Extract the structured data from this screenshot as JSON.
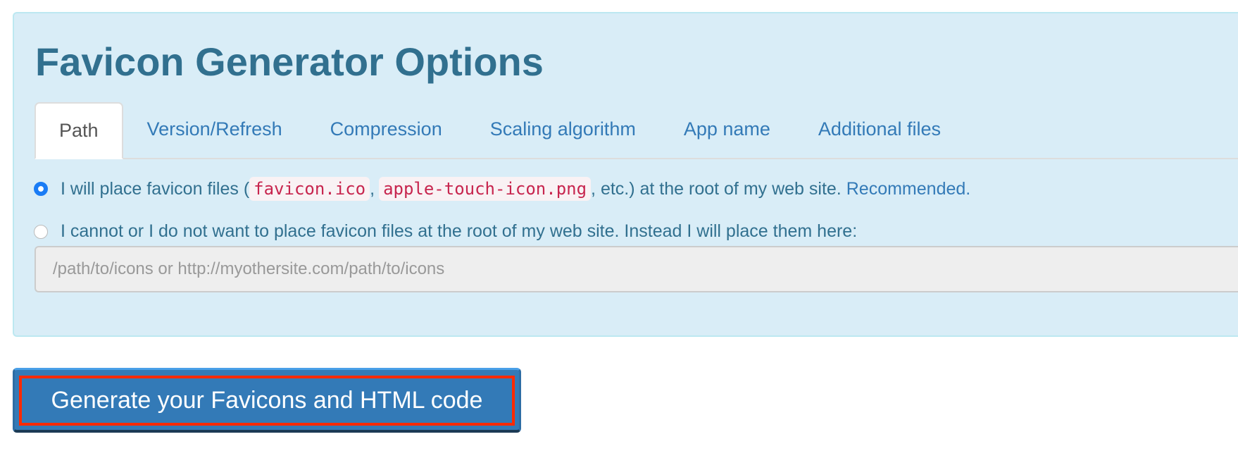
{
  "title": "Favicon Generator Options",
  "tabs": [
    {
      "label": "Path",
      "active": true
    },
    {
      "label": "Version/Refresh"
    },
    {
      "label": "Compression"
    },
    {
      "label": "Scaling algorithm"
    },
    {
      "label": "App name"
    },
    {
      "label": "Additional files"
    }
  ],
  "options": {
    "root": {
      "selected": true,
      "text_before": "I will place favicon files (",
      "code1": "favicon.ico",
      "sep": ",",
      "code2": "apple-touch-icon.png",
      "text_after": ", etc.) at the root of my web site.",
      "link": "Recommended."
    },
    "custom": {
      "selected": false,
      "text": "I cannot or I do not want to place favicon files at the root of my web site. Instead I will place them here:"
    }
  },
  "path_input": {
    "placeholder": "/path/to/icons or http://myothersite.com/path/to/icons",
    "value": ""
  },
  "generate_button": "Generate your Favicons and HTML code",
  "colors": {
    "panel": "#d9edf7",
    "text": "#31708f",
    "link": "#337ab7",
    "button": "#337ab7",
    "highlight": "#ff2a00"
  }
}
